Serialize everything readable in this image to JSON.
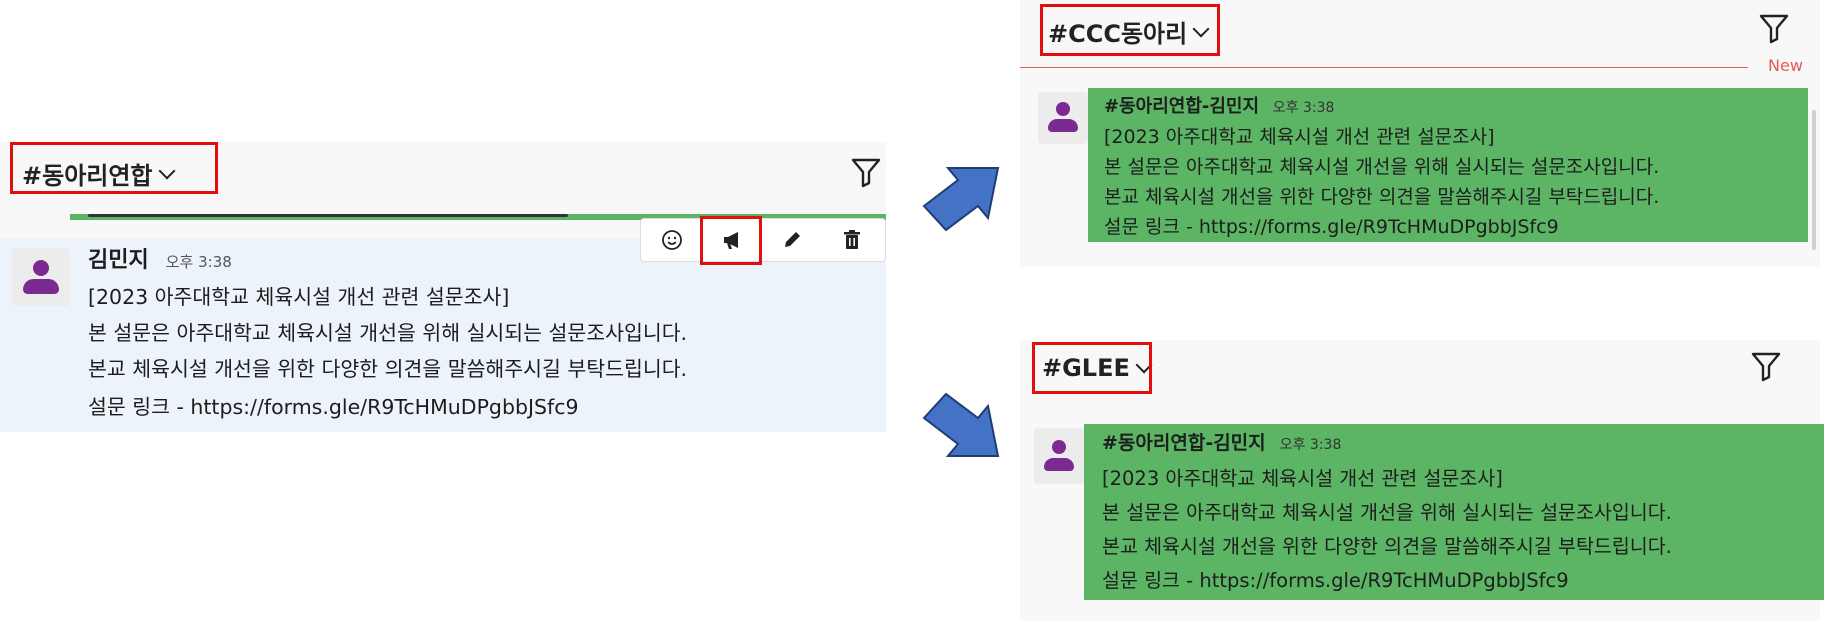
{
  "left_panel": {
    "channel_title": "#동아리연합",
    "message": {
      "author": "김민지",
      "time": "오후 3:38",
      "lines": [
        "[2023 아주대학교 체육시설 개선 관련 설문조사]",
        "본 설문은 아주대학교 체육시설 개선을 위해 실시되는 설문조사입니다.",
        "본교 체육시설 개선을 위한 다양한 의견을 말씀해주시길 부탁드립니다.",
        "설문 링크 - https://forms.gle/R9TcHMuDPgbbJSfc9"
      ]
    },
    "toolbar": [
      "emoji-icon",
      "megaphone-icon",
      "pencil-icon",
      "trash-icon"
    ]
  },
  "top_right_panel": {
    "channel_title": "#CCC동아리",
    "new_label": "New",
    "message": {
      "author": "#동아리연합-김민지",
      "time": "오후 3:38",
      "lines": [
        "[2023 아주대학교 체육시설 개선 관련 설문조사]",
        "본 설문은 아주대학교 체육시설 개선을 위해 실시되는 설문조사입니다.",
        "본교 체육시설 개선을 위한 다양한 의견을 말씀해주시길 부탁드립니다.",
        "설문 링크 - https://forms.gle/R9TcHMuDPgbbJSfc9"
      ]
    }
  },
  "bottom_right_panel": {
    "channel_title": "#GLEE",
    "message": {
      "author": "#동아리연합-김민지",
      "time": "오후 3:38",
      "lines": [
        "[2023 아주대학교 체육시설 개선 관련 설문조사]",
        "본 설문은 아주대학교 체육시설 개선을 위해 실시되는 설문조사입니다.",
        "본교 체육시설 개선을 위한 다양한 의견을 말씀해주시길 부탁드립니다.",
        "설문 링크 - https://forms.gle/R9TcHMuDPgbbJSfc9"
      ]
    }
  },
  "colors": {
    "highlight_red": "#e01010",
    "forward_green": "#5bb565",
    "arrow_blue": "#4472c4",
    "avatar_purple": "#7a2a90"
  }
}
